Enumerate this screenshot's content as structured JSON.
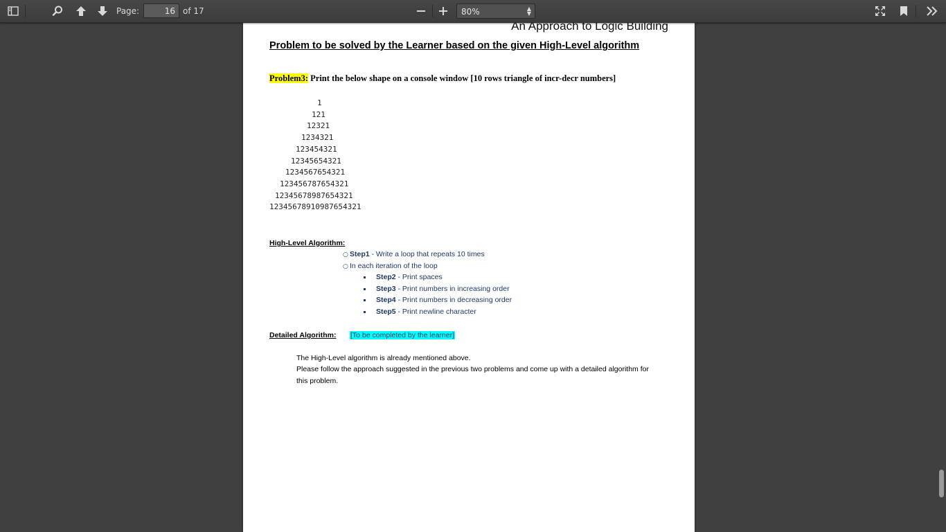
{
  "toolbar": {
    "page_label": "Page:",
    "page_value": "16",
    "page_total": "of 17",
    "zoom_value": "80%",
    "icons": [
      "sidebar-toggle-icon",
      "search-icon",
      "arrow-up-icon",
      "arrow-down-icon",
      "minus-icon",
      "plus-icon",
      "fullscreen-icon",
      "bookmark-icon",
      "chevron-double-right-icon"
    ]
  },
  "document": {
    "header_title": "An Approach to Logic Building",
    "section_heading": "Problem to be solved by the Learner based on the given High-Level algorithm",
    "problem_tag": "Problem3:",
    "problem_text": " Print the below shape on a console window [10 rows triangle of incr-decr numbers]",
    "triangle": [
      "1",
      "121",
      "12321",
      "1234321",
      "123454321",
      "12345654321",
      "1234567654321",
      "123456787654321",
      "12345678987654321",
      "12345678910987654321"
    ],
    "high_level_heading": "High-Level Algorithm:",
    "steps": {
      "step1_label": "Step1",
      "step1_text": " - Write a loop that repeats 10 times",
      "loop_text": "In each iteration of the loop",
      "step2_label": "Step2",
      "step2_text": " - Print spaces",
      "step3_label": "Step3",
      "step3_text": " - Print numbers in increasing order",
      "step4_label": "Step4",
      "step4_text": " - Print numbers in decreasing order",
      "step5_label": "Step5",
      "step5_text": " - Print newline character"
    },
    "detailed_heading": "Detailed Algorithm:",
    "detailed_note": "[To be completed by the learner]",
    "body_line1": "The High-Level algorithm is already mentioned above.",
    "body_line2": "Please follow the approach suggested in the previous two problems and come up with a detailed algorithm for",
    "body_line3": "this problem."
  }
}
